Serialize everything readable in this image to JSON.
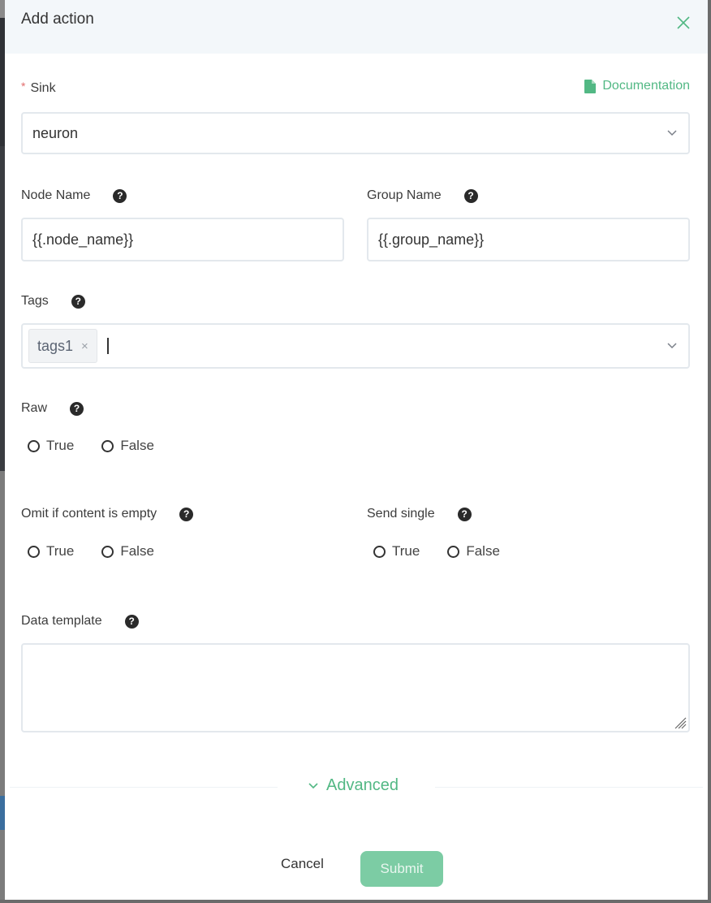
{
  "dialog": {
    "title": "Add action",
    "close_icon": "close-icon"
  },
  "documentation_link": {
    "label": "Documentation",
    "icon": "file-icon"
  },
  "colors": {
    "accent": "#52b884",
    "submit_bg": "#7ccca4",
    "required": "#e26d6d",
    "header_bg": "#f3f7fa"
  },
  "fields": {
    "sink": {
      "label": "Sink",
      "required": true,
      "value": "neuron"
    },
    "node_name": {
      "label": "Node Name",
      "value": "{{.node_name}}"
    },
    "group_name": {
      "label": "Group Name",
      "value": "{{.group_name}}"
    },
    "tags": {
      "label": "Tags",
      "tags": [
        "tags1"
      ]
    },
    "raw": {
      "label": "Raw",
      "options": [
        "True",
        "False"
      ],
      "selected": null
    },
    "omit_if_empty": {
      "label": "Omit if content is empty",
      "options": [
        "True",
        "False"
      ],
      "selected": null
    },
    "send_single": {
      "label": "Send single",
      "options": [
        "True",
        "False"
      ],
      "selected": null
    },
    "data_template": {
      "label": "Data template",
      "value": ""
    }
  },
  "advanced": {
    "label": "Advanced"
  },
  "footer": {
    "cancel_label": "Cancel",
    "submit_label": "Submit"
  }
}
